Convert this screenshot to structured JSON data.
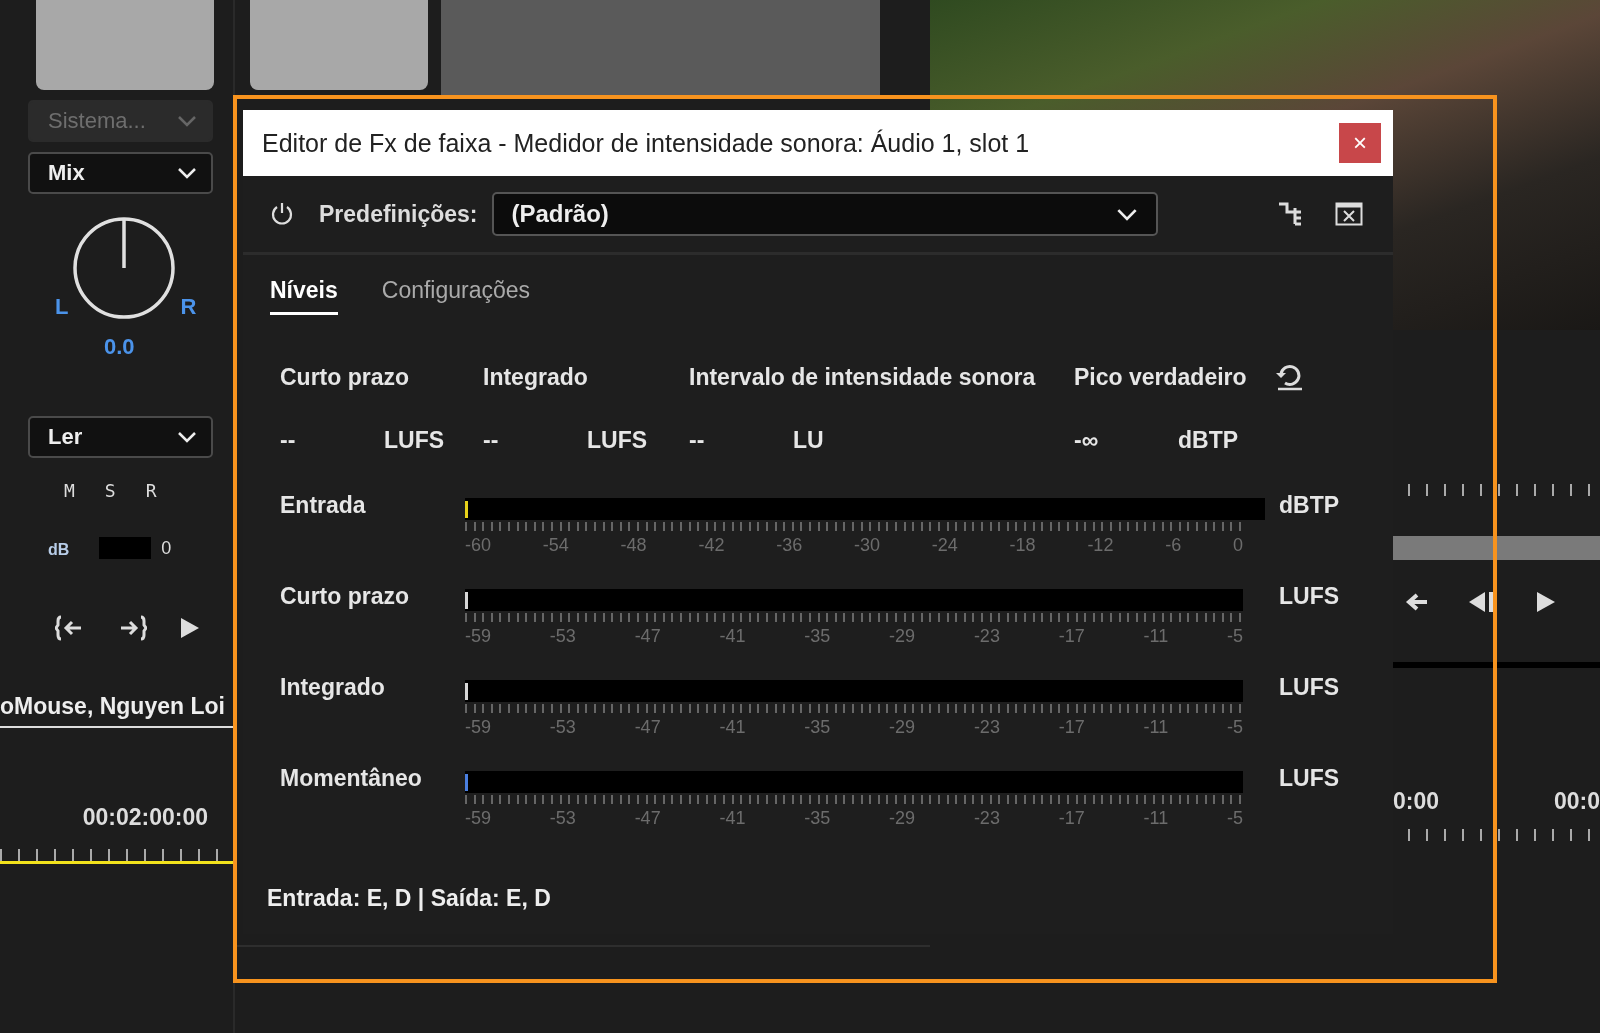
{
  "mixer_strip": {
    "output_dropdown": "Sistema...",
    "bus_dropdown": "Mix",
    "pan": {
      "left_label": "L",
      "right_label": "R",
      "value": "0.0"
    },
    "automation_dropdown": "Ler",
    "toggles": [
      "M",
      "S",
      "R"
    ],
    "meter_label": "dB",
    "meter_scale": "0"
  },
  "timeline_left": {
    "track_name": "oMouse, Nguyen Loi",
    "timecode": "00:02:00:00"
  },
  "timeline_right": {
    "timecodes": [
      "0:00",
      "00:0"
    ]
  },
  "dialog": {
    "title": "Editor de Fx de faixa - Medidor de intensidade sonora: Áudio 1, slot 1",
    "close": "×",
    "preset_label": "Predefinições:",
    "preset_value": "(Padrão)",
    "tabs": [
      {
        "label": "Níveis",
        "selected": true
      },
      {
        "label": "Configurações",
        "selected": false
      }
    ],
    "readouts": [
      {
        "label": "Curto prazo",
        "value": "--",
        "unit": "LUFS"
      },
      {
        "label": "Integrado",
        "value": "--",
        "unit": "LUFS"
      },
      {
        "label": "Intervalo de intensidade sonora",
        "value": "--",
        "unit": "LU"
      },
      {
        "label": "Pico verdadeiro",
        "value": "-∞",
        "unit": "dBTP"
      }
    ],
    "meters": [
      {
        "label": "Entrada",
        "unit": "dBTP",
        "level": 0,
        "color": "#e8d21a",
        "scale": [
          "-60",
          "-54",
          "-48",
          "-42",
          "-36",
          "-30",
          "-24",
          "-18",
          "-12",
          "-6",
          "0"
        ]
      },
      {
        "label": "Curto prazo",
        "unit": "LUFS",
        "level": 0,
        "color": "#d8d8d8",
        "scale": [
          "-59",
          "-53",
          "-47",
          "-41",
          "-35",
          "-29",
          "-23",
          "-17",
          "-11",
          "-5"
        ]
      },
      {
        "label": "Integrado",
        "unit": "LUFS",
        "level": 0,
        "color": "#d8d8d8",
        "scale": [
          "-59",
          "-53",
          "-47",
          "-41",
          "-35",
          "-29",
          "-23",
          "-17",
          "-11",
          "-5"
        ]
      },
      {
        "label": "Momentâneo",
        "unit": "LUFS",
        "level": 0,
        "color": "#4a7fe0",
        "scale": [
          "-59",
          "-53",
          "-47",
          "-41",
          "-35",
          "-29",
          "-23",
          "-17",
          "-11",
          "-5"
        ]
      }
    ],
    "footer": "Entrada: E, D | Saída: E, D"
  }
}
